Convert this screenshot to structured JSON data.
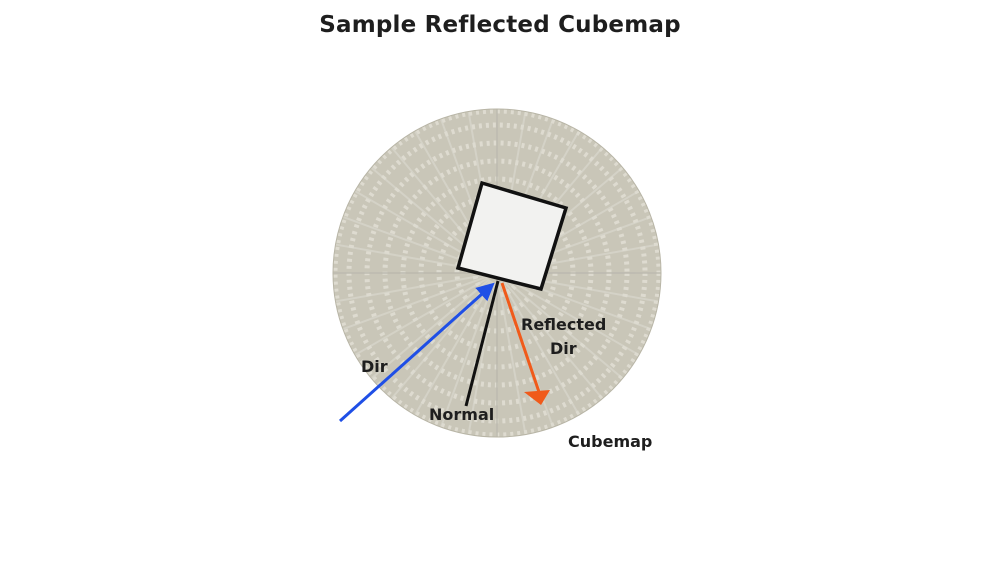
{
  "title": "Sample Reflected Cubemap",
  "labels": {
    "dir": "Dir",
    "normal": "Normal",
    "reflected_line1": "Reflected",
    "reflected_line2": "Dir",
    "cubemap": "Cubemap"
  },
  "colors": {
    "dir_arrow": "#1f4fe6",
    "reflected_arrow": "#f05a1a",
    "normal_line": "#111111",
    "cube_fill": "#f2f2f0",
    "cubemap_fill": "#c9c6b8",
    "cubemap_pattern": "#e2e0d6"
  }
}
